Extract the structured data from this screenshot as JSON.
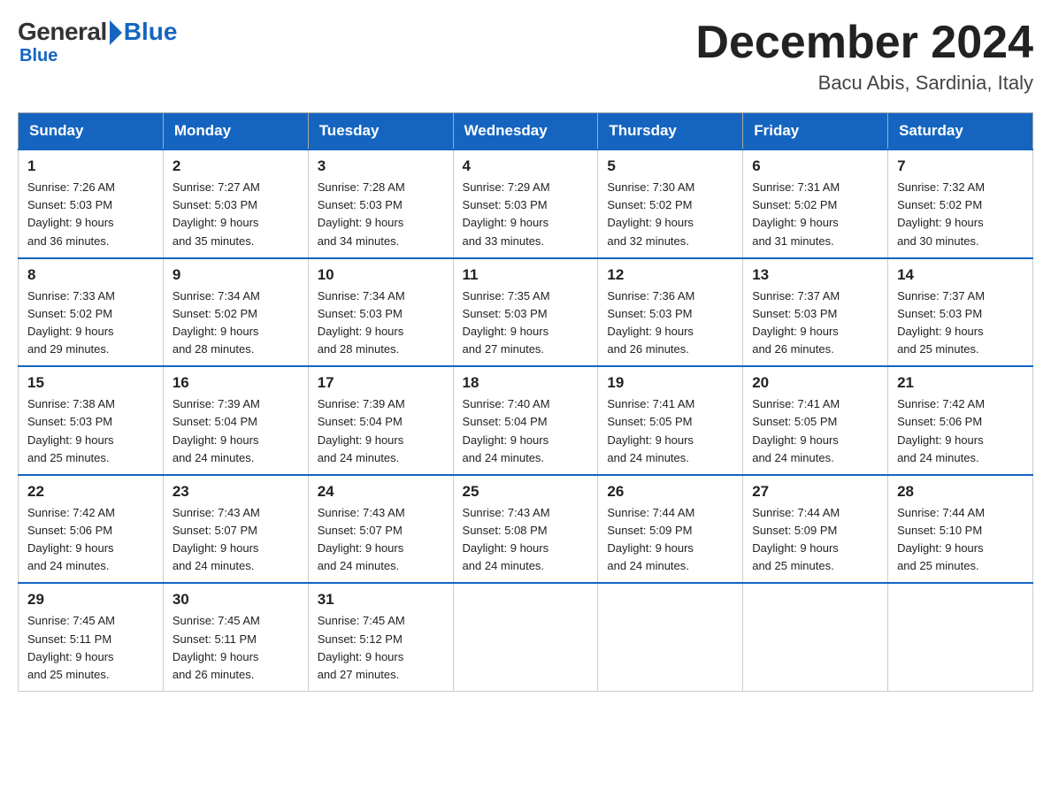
{
  "logo": {
    "general": "General",
    "blue": "Blue"
  },
  "title": {
    "month": "December 2024",
    "location": "Bacu Abis, Sardinia, Italy"
  },
  "headers": [
    "Sunday",
    "Monday",
    "Tuesday",
    "Wednesday",
    "Thursday",
    "Friday",
    "Saturday"
  ],
  "weeks": [
    [
      {
        "day": "1",
        "sunrise": "7:26 AM",
        "sunset": "5:03 PM",
        "daylight": "9 hours and 36 minutes."
      },
      {
        "day": "2",
        "sunrise": "7:27 AM",
        "sunset": "5:03 PM",
        "daylight": "9 hours and 35 minutes."
      },
      {
        "day": "3",
        "sunrise": "7:28 AM",
        "sunset": "5:03 PM",
        "daylight": "9 hours and 34 minutes."
      },
      {
        "day": "4",
        "sunrise": "7:29 AM",
        "sunset": "5:03 PM",
        "daylight": "9 hours and 33 minutes."
      },
      {
        "day": "5",
        "sunrise": "7:30 AM",
        "sunset": "5:02 PM",
        "daylight": "9 hours and 32 minutes."
      },
      {
        "day": "6",
        "sunrise": "7:31 AM",
        "sunset": "5:02 PM",
        "daylight": "9 hours and 31 minutes."
      },
      {
        "day": "7",
        "sunrise": "7:32 AM",
        "sunset": "5:02 PM",
        "daylight": "9 hours and 30 minutes."
      }
    ],
    [
      {
        "day": "8",
        "sunrise": "7:33 AM",
        "sunset": "5:02 PM",
        "daylight": "9 hours and 29 minutes."
      },
      {
        "day": "9",
        "sunrise": "7:34 AM",
        "sunset": "5:02 PM",
        "daylight": "9 hours and 28 minutes."
      },
      {
        "day": "10",
        "sunrise": "7:34 AM",
        "sunset": "5:03 PM",
        "daylight": "9 hours and 28 minutes."
      },
      {
        "day": "11",
        "sunrise": "7:35 AM",
        "sunset": "5:03 PM",
        "daylight": "9 hours and 27 minutes."
      },
      {
        "day": "12",
        "sunrise": "7:36 AM",
        "sunset": "5:03 PM",
        "daylight": "9 hours and 26 minutes."
      },
      {
        "day": "13",
        "sunrise": "7:37 AM",
        "sunset": "5:03 PM",
        "daylight": "9 hours and 26 minutes."
      },
      {
        "day": "14",
        "sunrise": "7:37 AM",
        "sunset": "5:03 PM",
        "daylight": "9 hours and 25 minutes."
      }
    ],
    [
      {
        "day": "15",
        "sunrise": "7:38 AM",
        "sunset": "5:03 PM",
        "daylight": "9 hours and 25 minutes."
      },
      {
        "day": "16",
        "sunrise": "7:39 AM",
        "sunset": "5:04 PM",
        "daylight": "9 hours and 24 minutes."
      },
      {
        "day": "17",
        "sunrise": "7:39 AM",
        "sunset": "5:04 PM",
        "daylight": "9 hours and 24 minutes."
      },
      {
        "day": "18",
        "sunrise": "7:40 AM",
        "sunset": "5:04 PM",
        "daylight": "9 hours and 24 minutes."
      },
      {
        "day": "19",
        "sunrise": "7:41 AM",
        "sunset": "5:05 PM",
        "daylight": "9 hours and 24 minutes."
      },
      {
        "day": "20",
        "sunrise": "7:41 AM",
        "sunset": "5:05 PM",
        "daylight": "9 hours and 24 minutes."
      },
      {
        "day": "21",
        "sunrise": "7:42 AM",
        "sunset": "5:06 PM",
        "daylight": "9 hours and 24 minutes."
      }
    ],
    [
      {
        "day": "22",
        "sunrise": "7:42 AM",
        "sunset": "5:06 PM",
        "daylight": "9 hours and 24 minutes."
      },
      {
        "day": "23",
        "sunrise": "7:43 AM",
        "sunset": "5:07 PM",
        "daylight": "9 hours and 24 minutes."
      },
      {
        "day": "24",
        "sunrise": "7:43 AM",
        "sunset": "5:07 PM",
        "daylight": "9 hours and 24 minutes."
      },
      {
        "day": "25",
        "sunrise": "7:43 AM",
        "sunset": "5:08 PM",
        "daylight": "9 hours and 24 minutes."
      },
      {
        "day": "26",
        "sunrise": "7:44 AM",
        "sunset": "5:09 PM",
        "daylight": "9 hours and 24 minutes."
      },
      {
        "day": "27",
        "sunrise": "7:44 AM",
        "sunset": "5:09 PM",
        "daylight": "9 hours and 25 minutes."
      },
      {
        "day": "28",
        "sunrise": "7:44 AM",
        "sunset": "5:10 PM",
        "daylight": "9 hours and 25 minutes."
      }
    ],
    [
      {
        "day": "29",
        "sunrise": "7:45 AM",
        "sunset": "5:11 PM",
        "daylight": "9 hours and 25 minutes."
      },
      {
        "day": "30",
        "sunrise": "7:45 AM",
        "sunset": "5:11 PM",
        "daylight": "9 hours and 26 minutes."
      },
      {
        "day": "31",
        "sunrise": "7:45 AM",
        "sunset": "5:12 PM",
        "daylight": "9 hours and 27 minutes."
      },
      null,
      null,
      null,
      null
    ]
  ],
  "labels": {
    "sunrise": "Sunrise:",
    "sunset": "Sunset:",
    "daylight": "Daylight:"
  }
}
